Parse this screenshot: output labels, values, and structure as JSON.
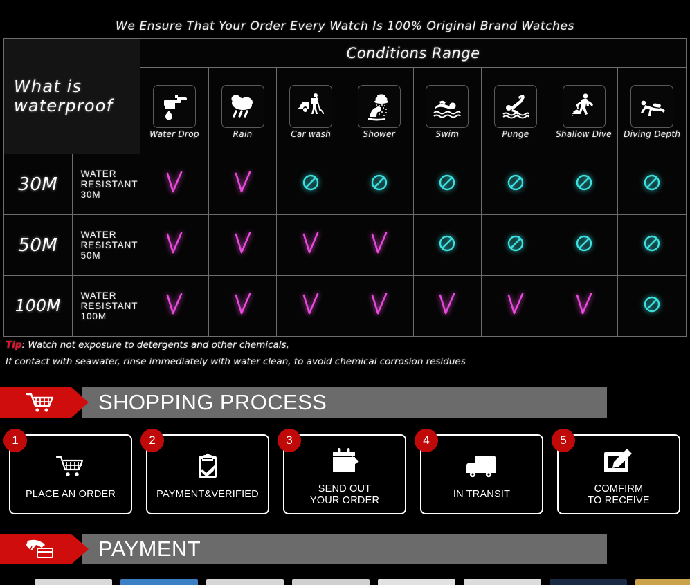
{
  "headline": "We Ensure That Your Order Every Watch Is 100% Original Brand Watches",
  "waterproof_table": {
    "left_header": "What is waterproof",
    "conditions_header": "Conditions Range",
    "columns": [
      {
        "icon": "faucet-water-drop-icon",
        "label": "Water Drop"
      },
      {
        "icon": "rain-cloud-icon",
        "label": "Rain"
      },
      {
        "icon": "car-wash-icon",
        "label": "Car wash"
      },
      {
        "icon": "shower-icon",
        "label": "Shower"
      },
      {
        "icon": "swimmer-icon",
        "label": "Swim"
      },
      {
        "icon": "diver-plunge-icon",
        "label": "Punge"
      },
      {
        "icon": "shallow-dive-icon",
        "label": "Shallow Dive"
      },
      {
        "icon": "scuba-diving-icon",
        "label": "Diving Depth"
      }
    ],
    "rows": [
      {
        "depth": "30M",
        "description": "WATER RESISTANT  30M",
        "marks": [
          "check",
          "check",
          "ban",
          "ban",
          "ban",
          "ban",
          "ban",
          "ban"
        ]
      },
      {
        "depth": "50M",
        "description": "WATER RESISTANT 50M",
        "marks": [
          "check",
          "check",
          "check",
          "check",
          "ban",
          "ban",
          "ban",
          "ban"
        ]
      },
      {
        "depth": "100M",
        "description": "WATER RESISTANT  100M",
        "marks": [
          "check",
          "check",
          "check",
          "check",
          "check",
          "check",
          "check",
          "ban"
        ]
      }
    ],
    "mark_colors": {
      "check": "#e64ad8",
      "ban": "#3ce0e0"
    }
  },
  "tip": {
    "keyword": "Tip",
    "line1": ": Watch not exposure to detergents and other chemicals,",
    "line2": "If contact with seawater, rinse immediately with water clean, to avoid chemical corrosion residues"
  },
  "banners": [
    {
      "icon": "shopping-cart-icon",
      "title": "SHOPPING PROCESS"
    },
    {
      "icon": "hand-card-swipe-icon",
      "title": "PAYMENT"
    }
  ],
  "shopping_steps": [
    {
      "number": "1",
      "icon": "shopping-cart-icon",
      "caption_line1": "PLACE AN ORDER",
      "caption_line2": ""
    },
    {
      "number": "2",
      "icon": "clipboard-check-icon",
      "caption_line1": "PAYMENT&VERIFIED",
      "caption_line2": ""
    },
    {
      "number": "3",
      "icon": "calendar-arrow-out-icon",
      "caption_line1": "SEND OUT",
      "caption_line2": "YOUR ORDER"
    },
    {
      "number": "4",
      "icon": "delivery-truck-icon",
      "caption_line1": "IN TRANSIT",
      "caption_line2": ""
    },
    {
      "number": "5",
      "icon": "sign-pencil-icon",
      "caption_line1": "COMFIRM",
      "caption_line2": "TO RECEIVE"
    }
  ],
  "payment_methods_strip": [
    {
      "color": "#d9d9d9"
    },
    {
      "color": "#3b7fc4"
    },
    {
      "color": "#d6d6d6"
    },
    {
      "color": "#cfcfcf"
    },
    {
      "color": "#e2e2e2"
    },
    {
      "color": "#dcdcdc"
    },
    {
      "color": "#1b2a44"
    },
    {
      "color": "#c9a24a"
    }
  ],
  "theme": {
    "background": "#000000",
    "banner_red": "#cf0d0d",
    "banner_grey": "#6b6b6b",
    "tip_red": "#e8102a"
  }
}
